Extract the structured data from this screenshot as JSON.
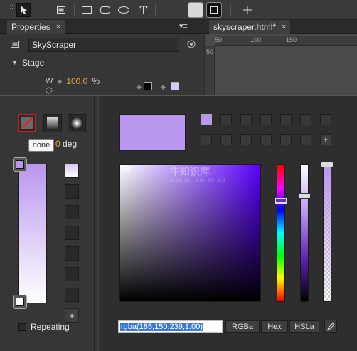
{
  "properties_panel": {
    "tab_label": "Properties",
    "tab_close": "×",
    "menu_glyph": "▾≡",
    "element_name": "SkyScraper",
    "stage_label": "Stage",
    "w_label": "W",
    "w_value": "100.0",
    "w_unit": "%"
  },
  "document": {
    "tab_label": "skyscraper.html*",
    "tab_close": "×",
    "ruler_h": [
      "50",
      "100",
      "150"
    ],
    "ruler_v": [
      "50"
    ]
  },
  "gradient_editor": {
    "tooltip": "none",
    "angle_value": "0",
    "angle_unit": "deg",
    "top_stop_color": "#b996ef",
    "bottom_stop_color": "#ffffff",
    "add_glyph": "+",
    "repeating_label": "Repeating"
  },
  "color_picker": {
    "current_color": "#b996ef",
    "value": "rgba(185,150,239,1.00)",
    "formats": [
      "RGBa",
      "Hex",
      "HSLa"
    ],
    "add_glyph": "+"
  },
  "watermark": {
    "text": "牛知识库",
    "sub": "XIAO NIU ZHI SHI KU"
  }
}
